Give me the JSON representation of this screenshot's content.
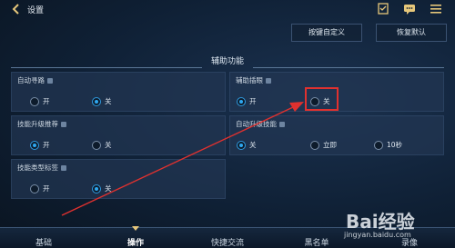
{
  "header": {
    "title": "设置",
    "custom_keys_label": "按键自定义",
    "restore_default_label": "恢复默认"
  },
  "section": {
    "title": "辅助功能"
  },
  "panels": {
    "auto_path": {
      "label": "自动寻路",
      "on": "开",
      "off": "关",
      "selected": "off"
    },
    "assist_eye": {
      "label": "辅助插眼",
      "on": "开",
      "off": "关",
      "selected": "on"
    },
    "skill_upgrade": {
      "label": "技能升级推荐",
      "on": "开",
      "off": "关",
      "selected": "on"
    },
    "auto_skill": {
      "label": "自动升级技能",
      "opt1": "关",
      "opt2": "立即",
      "opt3": "10秒",
      "selected": "opt1"
    },
    "skill_type_tag": {
      "label": "技能类型标签",
      "on": "开",
      "off": "关",
      "selected": "off"
    }
  },
  "tabs": [
    {
      "label": "基础"
    },
    {
      "label": "操作"
    },
    {
      "label": "快捷交流"
    },
    {
      "label": "黑名单"
    },
    {
      "label": "录像"
    }
  ],
  "watermark": {
    "main": "Bai经验",
    "sub": "jingyan.baidu.com"
  },
  "colors": {
    "accent": "#2fa8f0",
    "highlight": "#e0312f",
    "arrow": "#e0312f"
  }
}
